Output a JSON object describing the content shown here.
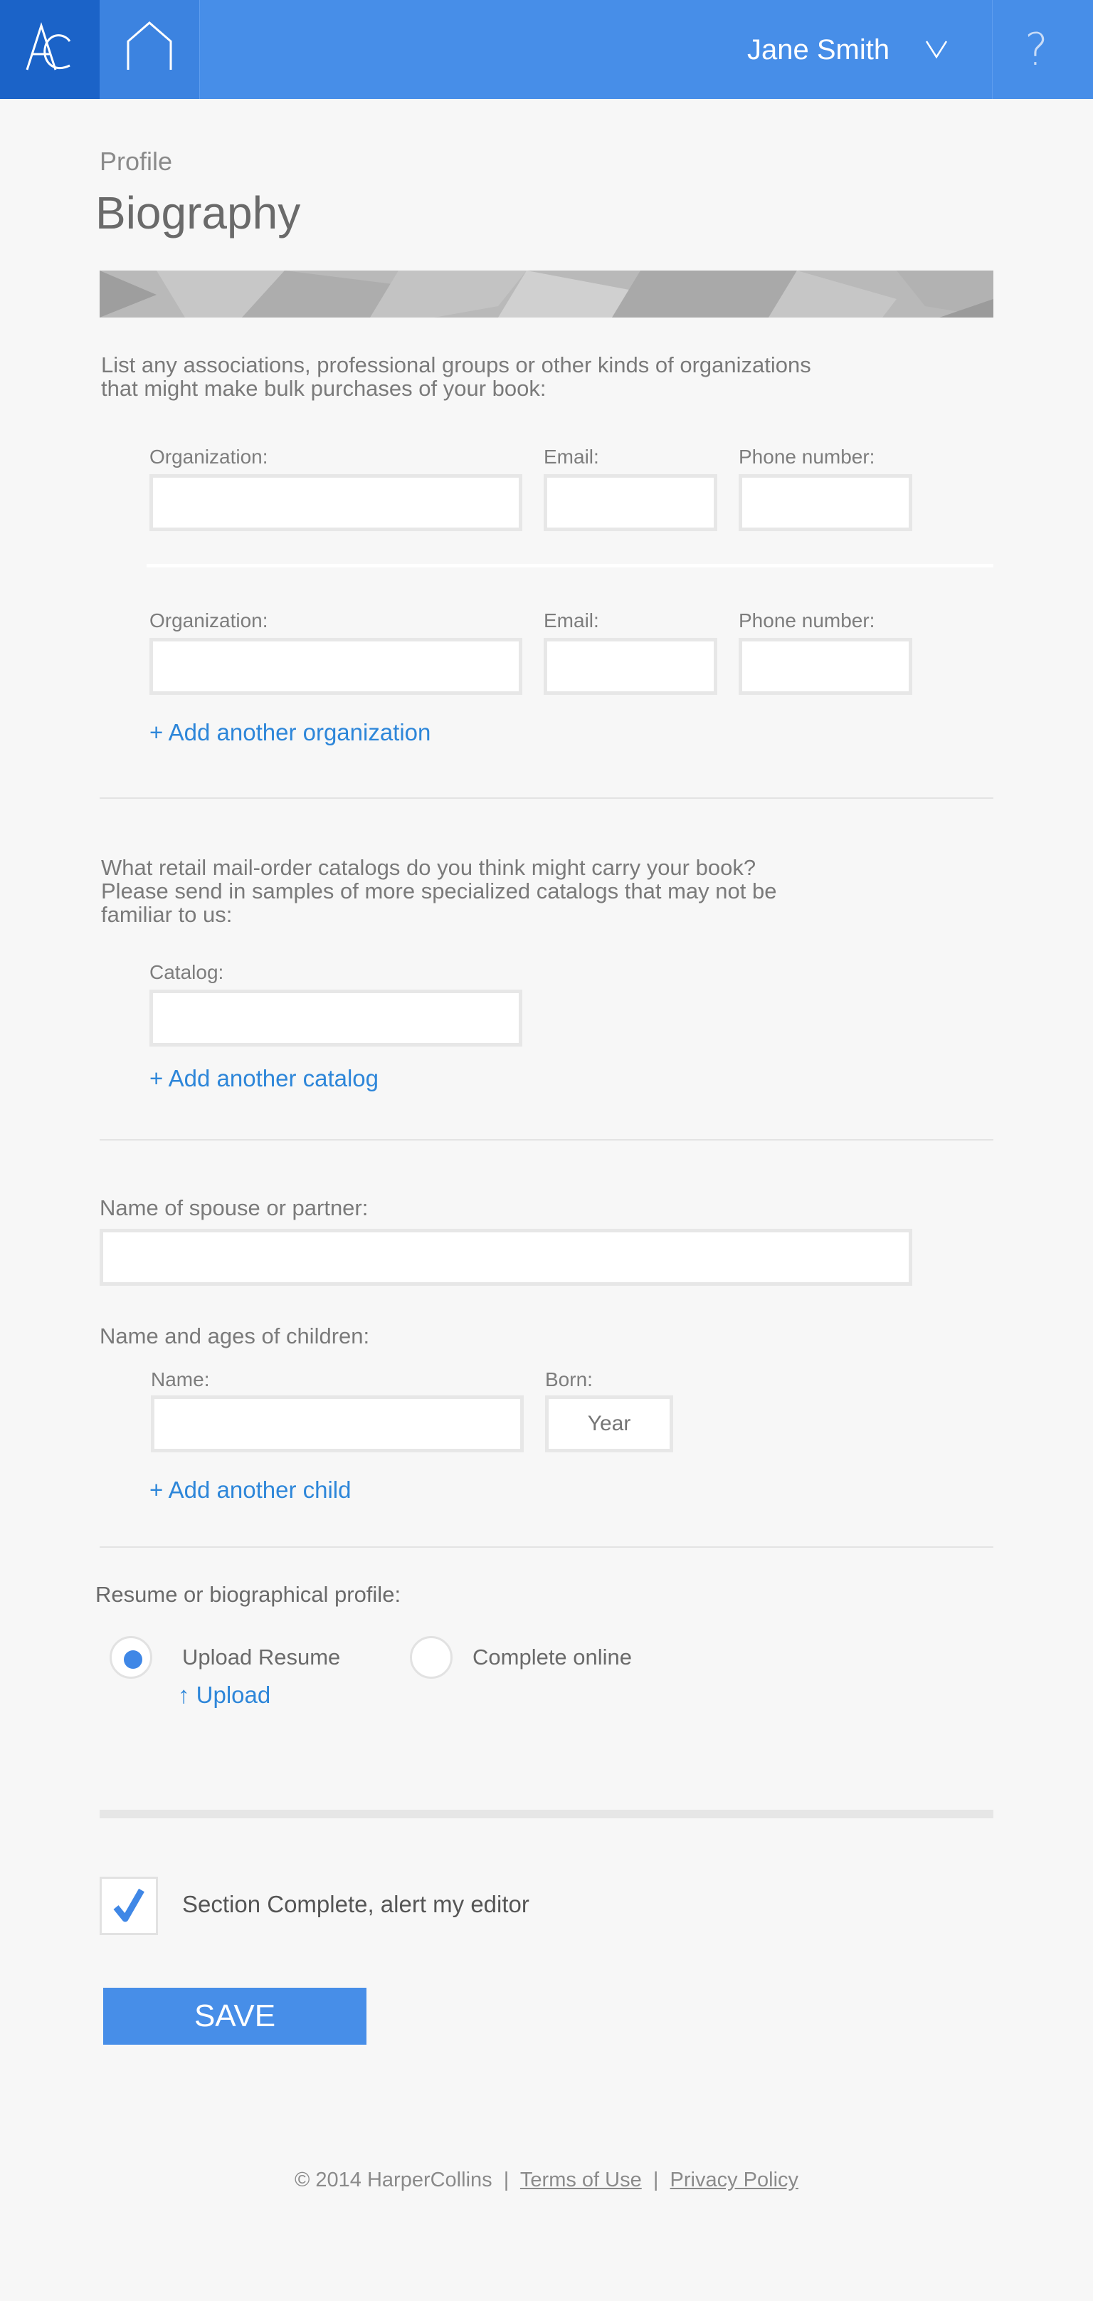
{
  "header": {
    "logo_text": "AC",
    "user_name": "Jane Smith",
    "help_glyph": "?",
    "icons": {
      "home": "home-icon",
      "user_menu": "chevron-down-icon",
      "help": "help-icon"
    },
    "colors": {
      "bar": "#478ee8",
      "logo_bg": "#1b63c8"
    }
  },
  "breadcrumb": "Profile",
  "title": "Biography",
  "organizations": {
    "question_line1": "List any associations, professional groups or other kinds of organizations",
    "question_line2": "that might make bulk purchases of your book:",
    "rows": [
      {
        "org_label": "Organization:",
        "email_label": "Email:",
        "phone_label": "Phone number:",
        "org_value": "",
        "email_value": "",
        "phone_value": ""
      },
      {
        "org_label": "Organization:",
        "email_label": "Email:",
        "phone_label": "Phone number:",
        "org_value": "",
        "email_value": "",
        "phone_value": ""
      }
    ],
    "add_link": "+ Add another organization"
  },
  "catalogs": {
    "question_line1": "What retail mail-order catalogs do you think might carry your book?",
    "question_line2": "Please send in samples of more specialized catalogs that may not be",
    "question_line3": "familiar to us:",
    "catalog_label": "Catalog:",
    "catalog_value": "",
    "add_link": "+ Add another catalog"
  },
  "spouse": {
    "label": "Name of spouse or partner:",
    "value": ""
  },
  "children": {
    "label": "Name and ages of children:",
    "name_label": "Name:",
    "born_label": "Born:",
    "name_value": "",
    "year_placeholder": "Year",
    "add_link": "+ Add another child"
  },
  "resume": {
    "label": "Resume or biographical profile:",
    "options": [
      {
        "label": "Upload Resume",
        "selected": true
      },
      {
        "label": "Complete online",
        "selected": false
      }
    ],
    "upload_link": "↑ Upload"
  },
  "section_complete": {
    "label": "Section Complete, alert my editor",
    "checked": true
  },
  "save_label": "SAVE",
  "footer": {
    "copyright": "© 2014 HarperCollins",
    "separator": "|",
    "terms": "Terms of Use",
    "privacy": "Privacy Policy"
  },
  "accent_color": "#2d86d9"
}
